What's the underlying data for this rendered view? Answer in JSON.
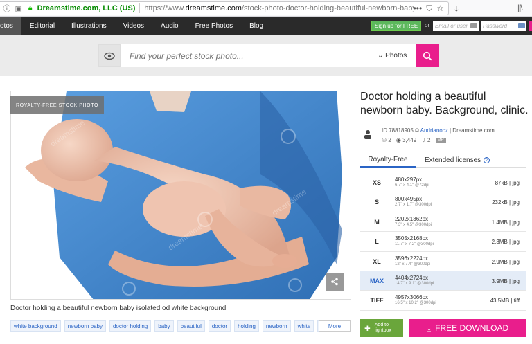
{
  "browser": {
    "site_identity": "Dreamstime.com, LLC (US)",
    "url_prefix": "https://www.",
    "url_domain": "dreamstime.com",
    "url_path": "/stock-photo-doctor-holding-beautiful-newborn-baby-isolate"
  },
  "nav": {
    "items": [
      "otos",
      "Editorial",
      "Illustrations",
      "Videos",
      "Audio",
      "Free Photos",
      "Blog"
    ],
    "signup_label": "Sign up for FREE",
    "or_label": "or",
    "email_placeholder": "Email or user",
    "password_placeholder": "Password"
  },
  "search": {
    "placeholder": "Find your perfect stock photo...",
    "type_label": "Photos"
  },
  "photo": {
    "badge": "ROYALTY-FREE STOCK PHOTO",
    "caption": "Doctor holding a beautiful newborn baby isolated od white background",
    "watermark": "dreamstime"
  },
  "tags": [
    "white background",
    "newborn baby",
    "doctor holding",
    "baby",
    "beautiful",
    "doctor",
    "holding",
    "newborn",
    "white",
    "i"
  ],
  "more_label": "More",
  "details": {
    "title": "Doctor holding a beautiful newborn baby. Background, clinic.",
    "id_text": "ID 78818905 ©",
    "author": "Andrianocz",
    "source": "| Dreamstime.com",
    "collections": "2",
    "views": "3,449",
    "downloads": "2",
    "release_badge": "MR"
  },
  "tabs": {
    "royalty_free": "Royalty-Free",
    "extended": "Extended licenses"
  },
  "sizes": [
    {
      "label": "XS",
      "dims": "480x297px",
      "sub": "6.7\" x 4.1\" @72dpi",
      "file": "87kB | jpg"
    },
    {
      "label": "S",
      "dims": "800x495px",
      "sub": "2.7\" x 1.7\" @300dpi",
      "file": "232kB | jpg"
    },
    {
      "label": "M",
      "dims": "2202x1362px",
      "sub": "7.3\" x 4.5\" @300dpi",
      "file": "1.4MB | jpg"
    },
    {
      "label": "L",
      "dims": "3505x2168px",
      "sub": "11.7\" x 7.2\" @300dpi",
      "file": "2.3MB | jpg"
    },
    {
      "label": "XL",
      "dims": "3596x2224px",
      "sub": "12\" x 7.4\" @300dpi",
      "file": "2.9MB | jpg"
    },
    {
      "label": "MAX",
      "dims": "4404x2724px",
      "sub": "14.7\" x 9.1\" @300dpi",
      "file": "3.9MB | jpg"
    },
    {
      "label": "TIFF",
      "dims": "4957x3066px",
      "sub": "16.5\" x 10.2\" @300dpi",
      "file": "43.5MB | tiff"
    }
  ],
  "selected_size": "MAX",
  "buttons": {
    "lightbox": "Add to lightbox",
    "free_download": "FREE DOWNLOAD"
  },
  "colors": {
    "brand_pink": "#e91e8c",
    "link_blue": "#2a64c5",
    "signup_green": "#5cb85c",
    "scrub_blue": "#4a8fd6"
  }
}
